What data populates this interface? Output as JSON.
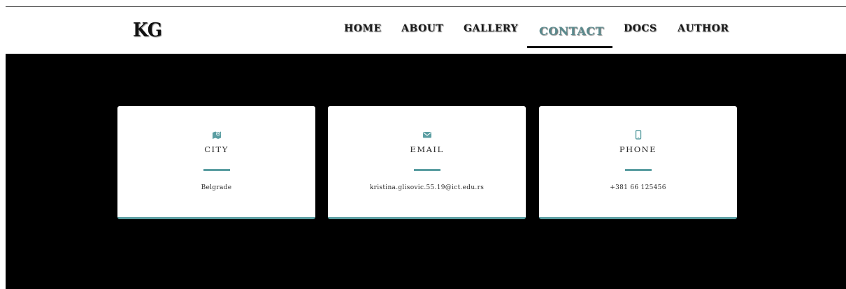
{
  "brand": "KG",
  "nav": {
    "items": [
      "HOME",
      "ABOUT",
      "GALLERY",
      "CONTACT",
      "DOCS",
      "AUTHOR"
    ],
    "active": "CONTACT"
  },
  "contact": {
    "cards": [
      {
        "icon": "map-icon",
        "title": "CITY",
        "text": "Belgrade"
      },
      {
        "icon": "envelope-icon",
        "title": "EMAIL",
        "text": "kristina.glisovic.55.19@ict.edu.rs"
      },
      {
        "icon": "phone-icon",
        "title": "PHONE",
        "text": "+381 66 125456"
      }
    ]
  },
  "colors": {
    "accent": "#5b9ea2",
    "nav_active": "#5b8a8d",
    "hero_bg": "#000000"
  }
}
